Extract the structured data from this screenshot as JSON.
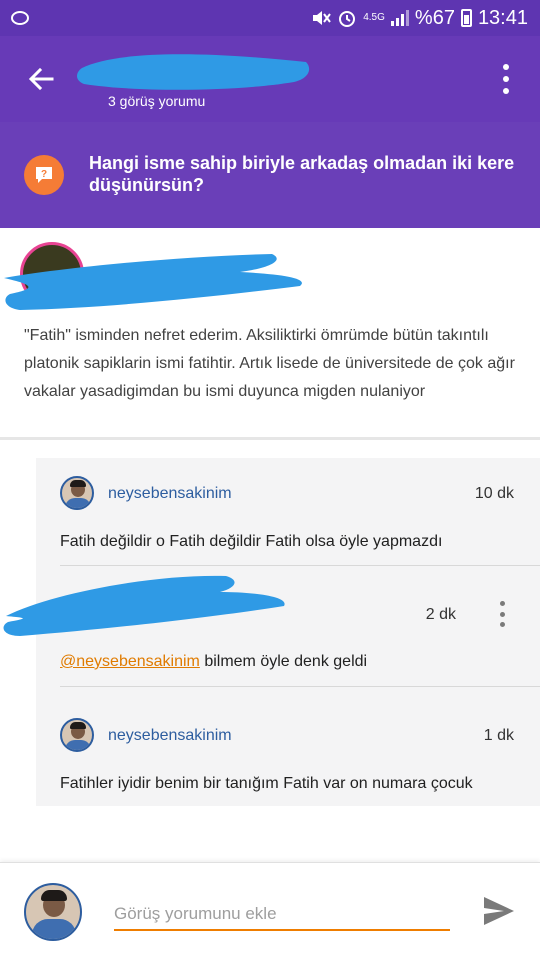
{
  "status_bar": {
    "network": "4.5G",
    "battery": "%67",
    "time": "13:41"
  },
  "app_bar": {
    "subtitle": "3 görüş yorumu"
  },
  "question": {
    "text": "Hangi isme sahip biriyle arkadaş olmadan iki kere düşünürsün?"
  },
  "opinion": {
    "text": "\"Fatih\" isminden nefret ederim. Aksiliktirki ömrümde bütün takıntılı platonik sapiklarin ismi fatihtir. Artık lisede de üniversitede de çok ağır vakalar yasadigimdan bu ismi duyunca migden nulaniyor"
  },
  "replies": [
    {
      "user": "neysebensakinim",
      "time": "10 dk",
      "text": "Fatih değildir o Fatih değildir Fatih olsa öyle yapmazdı"
    },
    {
      "user": "",
      "time": "2 dk",
      "mention": "@neysebensakinim",
      "text": " bilmem öyle denk geldi"
    },
    {
      "user": "neysebensakinim",
      "time": "1 dk",
      "text": "Fatihler iyidir benim bir tanığım Fatih var on numara çocuk"
    }
  ],
  "compose": {
    "placeholder": "Görüş yorumunu ekle"
  },
  "colors": {
    "app_bar": "#673ab7",
    "accent": "#ef7d00",
    "username": "#2d5d9f",
    "redaction": "#2f9ae5"
  }
}
